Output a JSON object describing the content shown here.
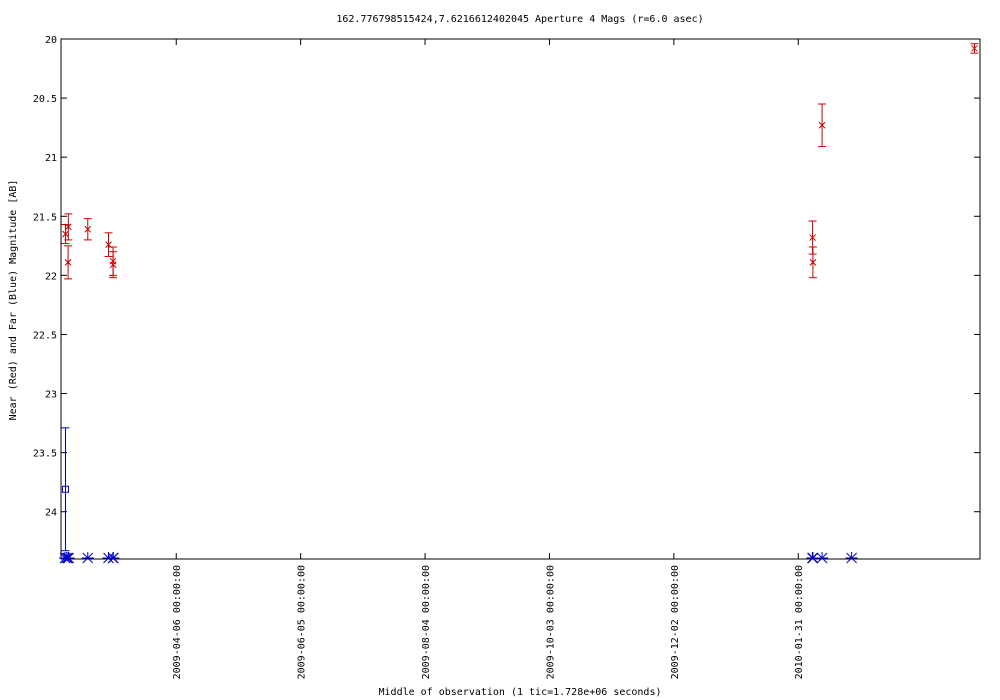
{
  "chart_data": {
    "type": "scatter",
    "title": "162.776798515424,7.6216612402045   Aperture 4 Mags (r=6.0 asec)",
    "xlabel": "Middle of observation (1 tic=1.728e+06 seconds)",
    "ylabel": "Near (Red) and Far (Blue) Magnitude [AB]",
    "y_inverted": true,
    "ylim": [
      20,
      24.4
    ],
    "xlim": [
      "2009-02-09 10:00:00",
      "2010-04-28 16:00:00"
    ],
    "y_ticks": [
      "20",
      "20.5",
      "21",
      "21.5",
      "22",
      "22.5",
      "23",
      "23.5",
      "24"
    ],
    "x_ticks": [
      "2009-04-06 00:00:00",
      "2009-06-05 00:00:00",
      "2009-08-04 00:00:00",
      "2009-10-03 00:00:00",
      "2009-12-02 00:00:00",
      "2010-01-31 00:00:00"
    ],
    "grid": false,
    "colors": {
      "near": "#cc0000",
      "far": "#0000cc",
      "frame": "#000000"
    },
    "near_points": [
      {
        "x": "2009-02-11 14:00:00",
        "y": 21.65,
        "err": 0.08
      },
      {
        "x": "2009-02-12 20:00:00",
        "y": 21.89,
        "err": 0.14
      },
      {
        "x": "2009-02-12 23:00:00",
        "y": 21.59,
        "err": 0.11
      },
      {
        "x": "2009-02-22 08:00:00",
        "y": 21.61,
        "err": 0.09
      },
      {
        "x": "2009-03-04 08:00:00",
        "y": 21.74,
        "err": 0.1
      },
      {
        "x": "2009-03-06 12:00:00",
        "y": 21.88,
        "err": 0.12
      },
      {
        "x": "2009-03-06 14:00:00",
        "y": 21.91,
        "err": 0.11
      },
      {
        "x": "2010-02-06 22:00:00",
        "y": 21.68,
        "err": 0.14
      },
      {
        "x": "2010-02-07 02:00:00",
        "y": 21.89,
        "err": 0.13
      },
      {
        "x": "2010-02-11 12:00:00",
        "y": 20.73,
        "err": 0.18
      },
      {
        "x": "2010-04-26 00:00:00",
        "y": 20.08,
        "err": 0.04
      }
    ],
    "far_points": [
      {
        "x": "2009-02-11 14:00:00",
        "y": 23.81,
        "err": 0.52,
        "marker": "square"
      }
    ],
    "far_upper_limits": [
      "2009-02-11 08:00:00",
      "2009-02-12 04:00:00",
      "2009-02-12 20:00:00",
      "2009-02-13 02:00:00",
      "2009-02-22 08:00:00",
      "2009-03-04 08:00:00",
      "2009-03-06 12:00:00",
      "2009-03-06 16:00:00",
      "2010-02-06 20:00:00",
      "2010-02-07 02:00:00",
      "2010-02-11 12:00:00",
      "2010-02-25 18:00:00"
    ]
  }
}
